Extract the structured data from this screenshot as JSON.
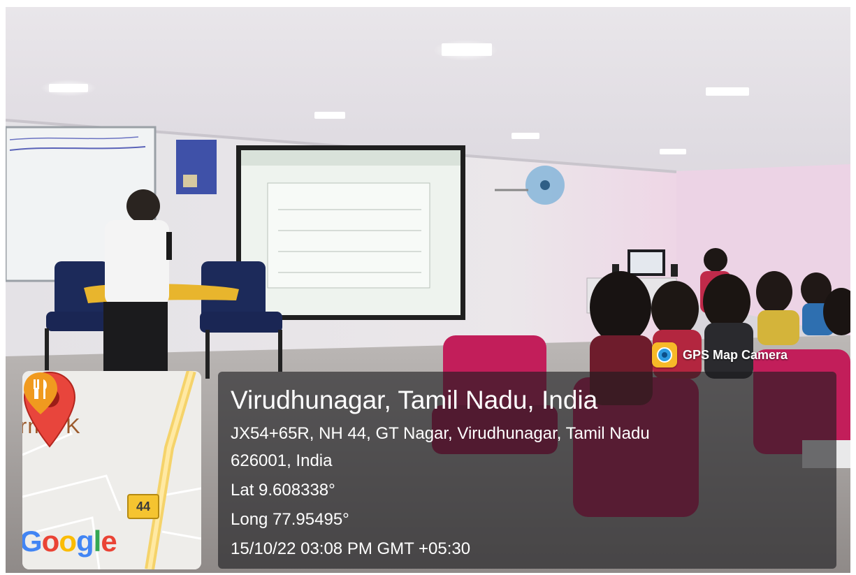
{
  "badge": {
    "app_name": "GPS Map Camera",
    "icon": "camera-icon"
  },
  "location": {
    "title": "Virudhunagar, Tamil Nadu, India",
    "address_line1": "JX54+65R, NH 44, GT Nagar, Virudhunagar, Tamil Nadu",
    "address_line2": "626001, India",
    "latitude": "Lat 9.608338°",
    "longitude": "Long 77.95495°",
    "timestamp": "15/10/22 03:08 PM GMT +05:30"
  },
  "map": {
    "street_label": "rma K",
    "route_number": "44",
    "logo": "Google",
    "pin_icon": "map-pin-icon",
    "poi_icon": "restaurant-icon"
  },
  "colors": {
    "pin": "#e8453c",
    "poi": "#f09a1f",
    "route_shield": "#f5c430",
    "overlay": "#1c1c1e"
  }
}
